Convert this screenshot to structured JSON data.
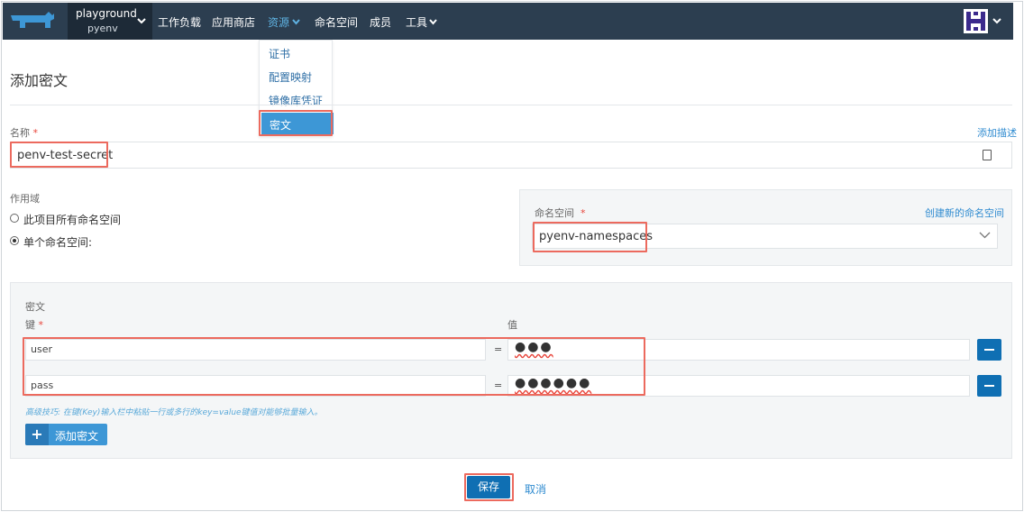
{
  "nav": {
    "project_name": "playground",
    "project_sub": "pyenv",
    "items": [
      "工作负载",
      "应用商店",
      "资源",
      "命名空间",
      "成员",
      "工具"
    ],
    "avatar_initial": "H"
  },
  "resource_menu": {
    "items": [
      "证书",
      "配置映射",
      "镜像库凭证",
      "密文"
    ],
    "active": "密文"
  },
  "page": {
    "title": "添加密文"
  },
  "name_field": {
    "label": "名称",
    "required_mark": "*",
    "value": "penv-test-secret",
    "add_description_link": "添加描述"
  },
  "scope": {
    "label": "作用域",
    "options": [
      "此项目所有命名空间",
      "单个命名空间:"
    ],
    "selected_index": 1
  },
  "namespace": {
    "label": "命名空间",
    "required_mark": "*",
    "create_link": "创建新的命名空间",
    "value": "pyenv-namespaces"
  },
  "secrets": {
    "section_label": "密文",
    "key_header": "键",
    "value_header": "值",
    "required_mark": "*",
    "separator": "=",
    "rows": [
      {
        "key": "user",
        "value_masked": "●●●"
      },
      {
        "key": "pass",
        "value_masked": "●●●●●●"
      }
    ],
    "tip": "高级技巧: 在键(Key)输入栏中粘贴一行或多行的key=value键值对能够批量输入。",
    "add_label": "添加密文",
    "add_icon": "+"
  },
  "actions": {
    "save": "保存",
    "cancel": "取消"
  },
  "colors": {
    "topbar": "#2c3e50",
    "accent": "#0f6fb3",
    "link": "#2f8bd0",
    "highlight": "#ec6a5e"
  }
}
